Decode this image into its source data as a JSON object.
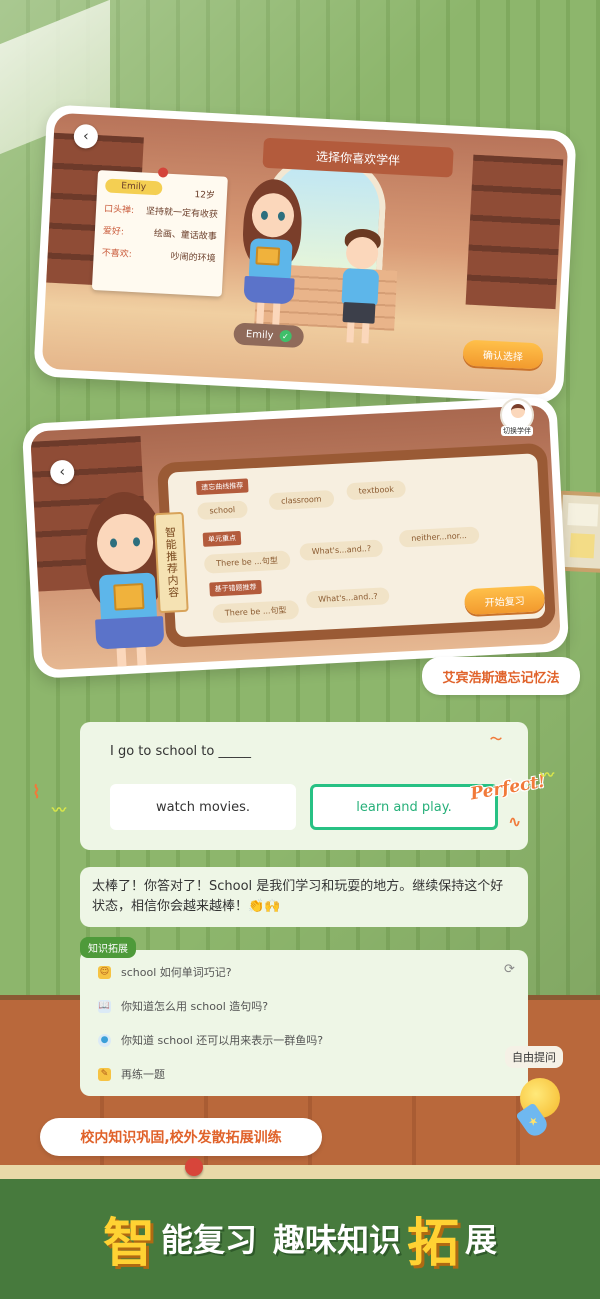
{
  "card1": {
    "title": "选择你喜欢学伴",
    "back_icon": "‹",
    "profile": {
      "name": "Emily",
      "age": "12岁",
      "rows": [
        {
          "key": "口头禅:",
          "value": "坚持就一定有收获"
        },
        {
          "key": "爱好:",
          "value": "绘画、童话故事"
        },
        {
          "key": "不喜欢:",
          "value": "吵闹的环境"
        }
      ]
    },
    "selected_name": "Emily",
    "check_icon": "✓",
    "confirm_label": "确认选择"
  },
  "card2": {
    "back_icon": "‹",
    "side_label": "智能推荐内容",
    "switch_label": "切换学伴",
    "sections": [
      {
        "label": "遗忘曲线推荐",
        "chips": [
          "school",
          "classroom",
          "textbook"
        ]
      },
      {
        "label": "单元重点",
        "chips": [
          "There be ...句型",
          "What's...and..?",
          "neither...nor..."
        ]
      },
      {
        "label": "基于错题推荐",
        "chips": [
          "There be ...句型",
          "What's...and..?"
        ]
      }
    ],
    "start_label": "开始复习"
  },
  "bubble_ebbinghaus": "艾宾浩斯遗忘记忆法",
  "quiz": {
    "question": "I go to school to _____",
    "option_a": "watch movies.",
    "option_b": "learn and play.",
    "perfect": "Perfect!"
  },
  "reply": "太棒了！你答对了！School 是我们学习和玩耍的地方。继续保持这个好状态，相信你会越来越棒！👏🙌",
  "knowledge": {
    "tag": "知识拓展",
    "refresh_icon": "⟳",
    "items": [
      {
        "icon": "☺",
        "text": "school 如何单词巧记?"
      },
      {
        "icon": "📖",
        "text": "你知道怎么用 school 造句吗?"
      },
      {
        "icon": "●",
        "text": "你知道 school 还可以用来表示一群鱼吗?"
      },
      {
        "icon": "✎",
        "text": "再练一题"
      }
    ]
  },
  "ask_label": "自由提问",
  "mic_icon": "★",
  "bottom_pill": "校内知识巩固,校外发散拓展训练",
  "headline": {
    "c1": "智",
    "t1": "能复习",
    "t2": "趣味知识",
    "c2": "拓",
    "t3": "展"
  },
  "colors": {
    "accent_orange": "#f29a2e",
    "correct_green": "#27c184",
    "wall_green": "#8db66c",
    "title_brown": "#b35b3c"
  }
}
